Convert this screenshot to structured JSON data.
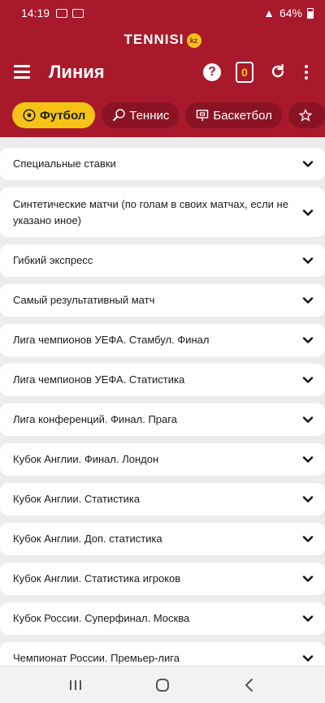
{
  "status": {
    "time": "14:19",
    "battery": "64%"
  },
  "app": {
    "brand": "TENNISI",
    "brand_badge": "kz",
    "title": "Линия",
    "coupon_count": "0"
  },
  "tabs": [
    {
      "label": "Футбол",
      "icon": "soccer-ball-icon",
      "active": true
    },
    {
      "label": "Теннис",
      "icon": "tennis-racket-icon",
      "active": false
    },
    {
      "label": "Баскетбол",
      "icon": "basketball-board-icon",
      "active": false
    },
    {
      "label": "",
      "icon": "star-icon",
      "active": false
    }
  ],
  "items": [
    {
      "label": "Специальные ставки"
    },
    {
      "label": "Синтетические матчи (по голам в своих матчах, если не указано иное)"
    },
    {
      "label": "Гибкий экспресс"
    },
    {
      "label": "Самый результативный матч"
    },
    {
      "label": "Лига чемпионов УЕФА. Стамбул. Финал"
    },
    {
      "label": "Лига чемпионов УЕФА. Статистика"
    },
    {
      "label": "Лига конференций. Финал. Прага"
    },
    {
      "label": "Кубок Англии. Финал. Лондон"
    },
    {
      "label": "Кубок Англии. Статистика"
    },
    {
      "label": "Кубок Англии. Доп. статистика"
    },
    {
      "label": "Кубок Англии. Статистика игроков"
    },
    {
      "label": "Кубок России. Суперфинал. Москва"
    },
    {
      "label": "Чемпионат России. Премьер-лига"
    }
  ],
  "colors": {
    "primary": "#a8192c",
    "accent": "#f4c316",
    "background": "#ececec"
  }
}
